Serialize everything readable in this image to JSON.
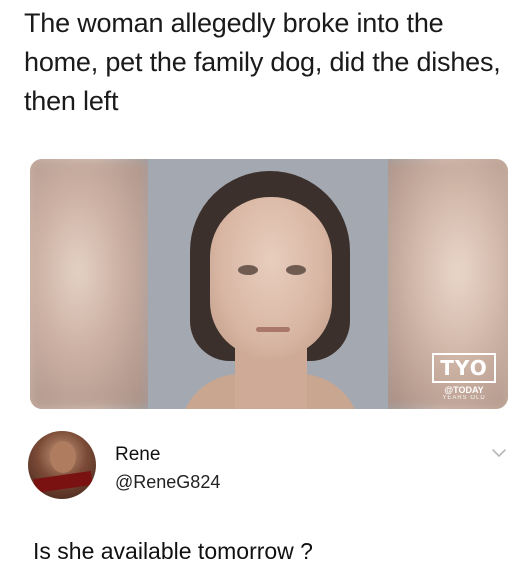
{
  "post": {
    "headline": "The woman allegedly broke into the home, pet the family dog, did the dishes, then left",
    "image": {
      "logo_mark": "TYO",
      "logo_brand": "@TODAY",
      "logo_sub": "YEARS OLD"
    }
  },
  "reply": {
    "author_name": "Rene",
    "author_handle": "@ReneG824",
    "text": "Is she available tomorrow ?",
    "menu_icon": "chevron-down-icon"
  }
}
